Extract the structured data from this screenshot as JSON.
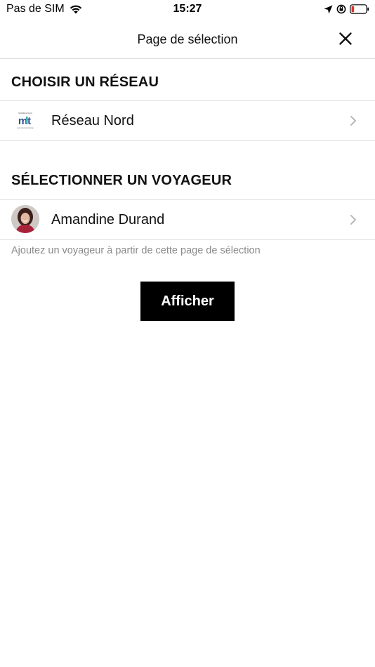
{
  "status_bar": {
    "carrier": "Pas de SIM",
    "time": "15:27",
    "battery_color": "#e0332b"
  },
  "header": {
    "title": "Page de sélection",
    "close_icon": "close-icon"
  },
  "network_section": {
    "heading": "CHOISIR UN RÉSEAU",
    "item": {
      "label": "Réseau Nord",
      "logo_text": "mt",
      "logo_caption": "Mobilités Nord",
      "logo_subcaption": "sur ma commune"
    }
  },
  "traveler_section": {
    "heading": "SÉLECTIONNER UN VOYAGEUR",
    "item": {
      "label": "Amandine Durand"
    },
    "hint": "Ajoutez un voyageur à partir de cette page de sélection"
  },
  "actions": {
    "show_label": "Afficher"
  }
}
